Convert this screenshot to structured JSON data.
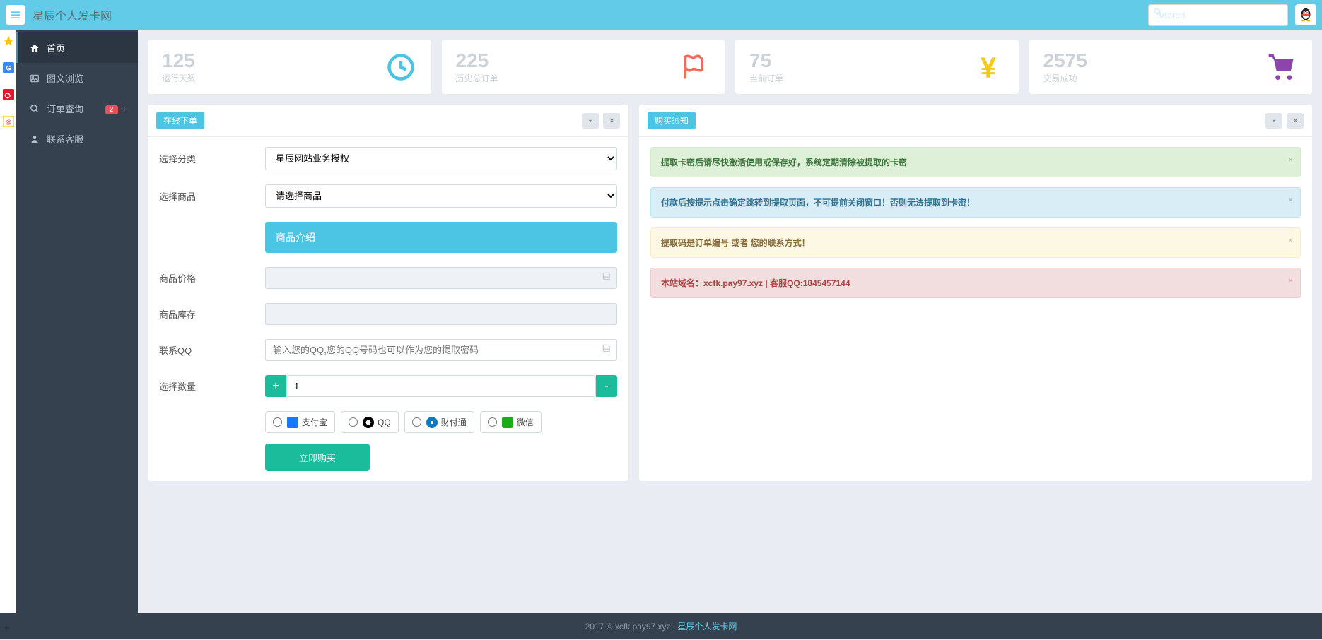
{
  "header": {
    "brand": "星辰个人发卡网",
    "search_placeholder": "Search"
  },
  "sidebar": {
    "items": [
      {
        "icon": "home",
        "label": "首页",
        "active": true
      },
      {
        "icon": "picture",
        "label": "图文浏览"
      },
      {
        "icon": "search",
        "label": "订单查询",
        "badge": "2",
        "plus": "+"
      },
      {
        "icon": "user",
        "label": "联系客服"
      }
    ]
  },
  "stats": [
    {
      "value": "125",
      "label": "运行天数",
      "icon": "clock",
      "color": "#4cc5e4"
    },
    {
      "value": "225",
      "label": "历史总订单",
      "icon": "flag",
      "color": "#f36a5a"
    },
    {
      "value": "75",
      "label": "当前订单",
      "icon": "yen",
      "color": "#f7ca18"
    },
    {
      "value": "2575",
      "label": "交易成功",
      "icon": "cart",
      "color": "#8e44ad"
    }
  ],
  "order_panel": {
    "title": "在线下单",
    "category_label": "选择分类",
    "category_value": "星辰网站业务授权",
    "product_label": "选择商品",
    "product_value": "请选择商品",
    "intro_label": "商品介绍",
    "price_label": "商品价格",
    "stock_label": "商品库存",
    "qq_label": "联系QQ",
    "qq_placeholder": "输入您的QQ,您的QQ号码也可以作为您的提取密码",
    "qty_label": "选择数量",
    "qty_value": "1",
    "pay": {
      "alipay": "支付宝",
      "qq": "QQ",
      "tenpay": "财付通",
      "wechat": "微信"
    },
    "buy_btn": "立即购买"
  },
  "notice_panel": {
    "title": "购买须知",
    "alerts": [
      {
        "type": "success",
        "text": "提取卡密后请尽快激活使用或保存好，系统定期清除被提取的卡密"
      },
      {
        "type": "info",
        "text": "付款后按提示点击确定跳转到提取页面，不可提前关闭窗口！否则无法提取到卡密！"
      },
      {
        "type": "warning",
        "text": "提取码是订单编号 或者 您的联系方式！"
      },
      {
        "type": "danger",
        "text": "本站域名：xcfk.pay97.xyz | 客服QQ:1845457144"
      }
    ]
  },
  "footer": {
    "text": "2017 © xcfk.pay97.xyz | ",
    "link": "星辰个人发卡网"
  }
}
